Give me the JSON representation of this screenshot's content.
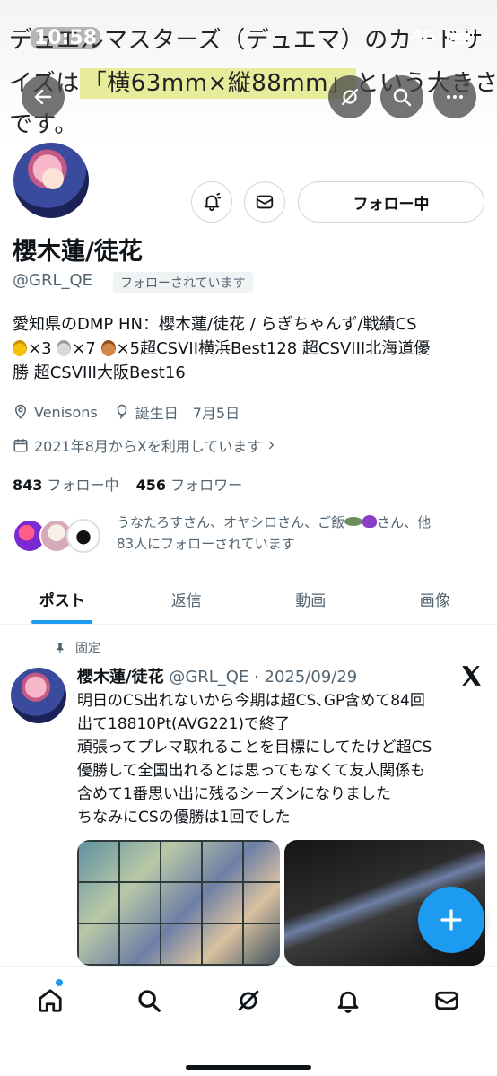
{
  "status_bar": {
    "time": "10:58",
    "network": "4G"
  },
  "banner": {
    "line1": "デュエルマスターズ（デュエマ）のカードサ",
    "line2_before": "イズは",
    "line2_highlight": "「横63mm×縦88mm」",
    "line2_after": "という大きさ",
    "line3": "です。"
  },
  "profile": {
    "name": "櫻木蓮/徒花",
    "handle": "@GRL_QE",
    "follows_you": "フォローされています",
    "follow_button": "フォロー中",
    "bio_line1": "愛知県のDMP HN：櫻木蓮/徒花 / らぎちゃんず/戦績CS",
    "bio_gold_count": "×3",
    "bio_silver_count": "×7",
    "bio_bronze_count": "×5",
    "bio_line2_rest": "超CSVII横浜Best128 超CSVIII北海道優",
    "bio_line3": "勝 超CSVIII大阪Best16",
    "location": "Venisons",
    "birthday": "誕生日　7月5日",
    "joined": "2021年8月からXを利用しています",
    "following_count": "843",
    "following_label": "フォロー中",
    "followers_count": "456",
    "followers_label": "フォロワー",
    "followed_by_part1": "うなたろすさん、オヤシロさん、ご飯",
    "followed_by_part2": "さん、他",
    "followed_by_line2": "83人にフォローされています"
  },
  "tabs": [
    {
      "label": "ポスト",
      "active": true
    },
    {
      "label": "返信",
      "active": false
    },
    {
      "label": "動画",
      "active": false
    },
    {
      "label": "画像",
      "active": false
    }
  ],
  "post": {
    "pinned_label": "固定",
    "author": "櫻木蓮/徒花",
    "meta": "@GRL_QE · 2025/09/29",
    "lines": [
      "明日のCS出れないから今期は超CS､GP含めて84回",
      "出て18810Pt(AVG221)で終了",
      "頑張ってプレマ取れることを目標にしてたけど超CS",
      "優勝して全国出れるとは思ってもなくて友人関係も",
      "含めて1番思い出に残るシーズンになりました",
      "ちなみにCSの優勝は1回でした"
    ]
  },
  "icons": {
    "back": "back-arrow-icon",
    "grok": "grok-icon",
    "search": "search-icon",
    "more": "more-icon",
    "notify": "notification-bell-icon",
    "message": "message-icon",
    "compose": "plus-icon"
  },
  "colors": {
    "accent": "#1d9bf0",
    "text": "#0f1419",
    "muted": "#536471"
  }
}
